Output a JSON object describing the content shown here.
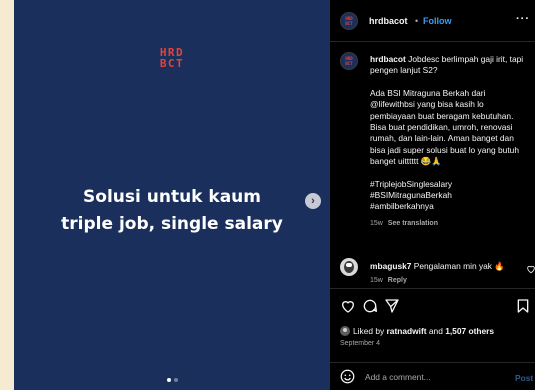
{
  "post_image": {
    "logo_line1": "HRD",
    "logo_line2": "BCT",
    "headline_line1": "Solusi untuk kaum",
    "headline_line2": "triple job, single salary",
    "next_arrow": "›",
    "colors": {
      "background": "#1b2f5c",
      "logo": "#e0443c",
      "text": "#ffffff"
    }
  },
  "header": {
    "username": "hrdbacot",
    "separator": "•",
    "follow_label": "Follow",
    "more": "···"
  },
  "caption": {
    "username": "hrdbacot",
    "line1": "Jobdesc berlimpah gaji irit, tapi pengen lanjut S2?",
    "paragraph": "Ada BSI Mitraguna Berkah dari @lifewithbsi yang bisa kasih lo pembiayaan buat beragam kebutuhan. Bisa buat pendidikan, umroh, renovasi rumah, dan lain-lain. Aman banget dan bisa jadi super solusi buat lo yang butuh banget uitttttt 😂🙏",
    "hashtag1": "#TriplejobSinglesalary",
    "hashtag2": "#BSIMitragunaBerkah",
    "hashtag3": "#ambilberkahnya",
    "time": "15w",
    "see_translation": "See translation"
  },
  "comment": {
    "username": "mbagusk7",
    "text": "Pengalaman min yak 🔥",
    "time": "15w",
    "reply_label": "Reply"
  },
  "likes": {
    "prefix": "Liked by",
    "user": "ratnadwift",
    "connector": "and",
    "others": "1,507 others",
    "date": "September 4"
  },
  "add_comment": {
    "placeholder": "Add a comment...",
    "post_label": "Post"
  },
  "icons": [
    "heart-icon",
    "comment-icon",
    "share-icon",
    "bookmark-icon",
    "emoji-icon",
    "chevron-right-icon"
  ],
  "accent_colors": {
    "follow": "#3b9cf6",
    "post_disabled": "#2a5d8e",
    "panel_bg": "#000000",
    "page_bg": "#f6ebd0"
  }
}
